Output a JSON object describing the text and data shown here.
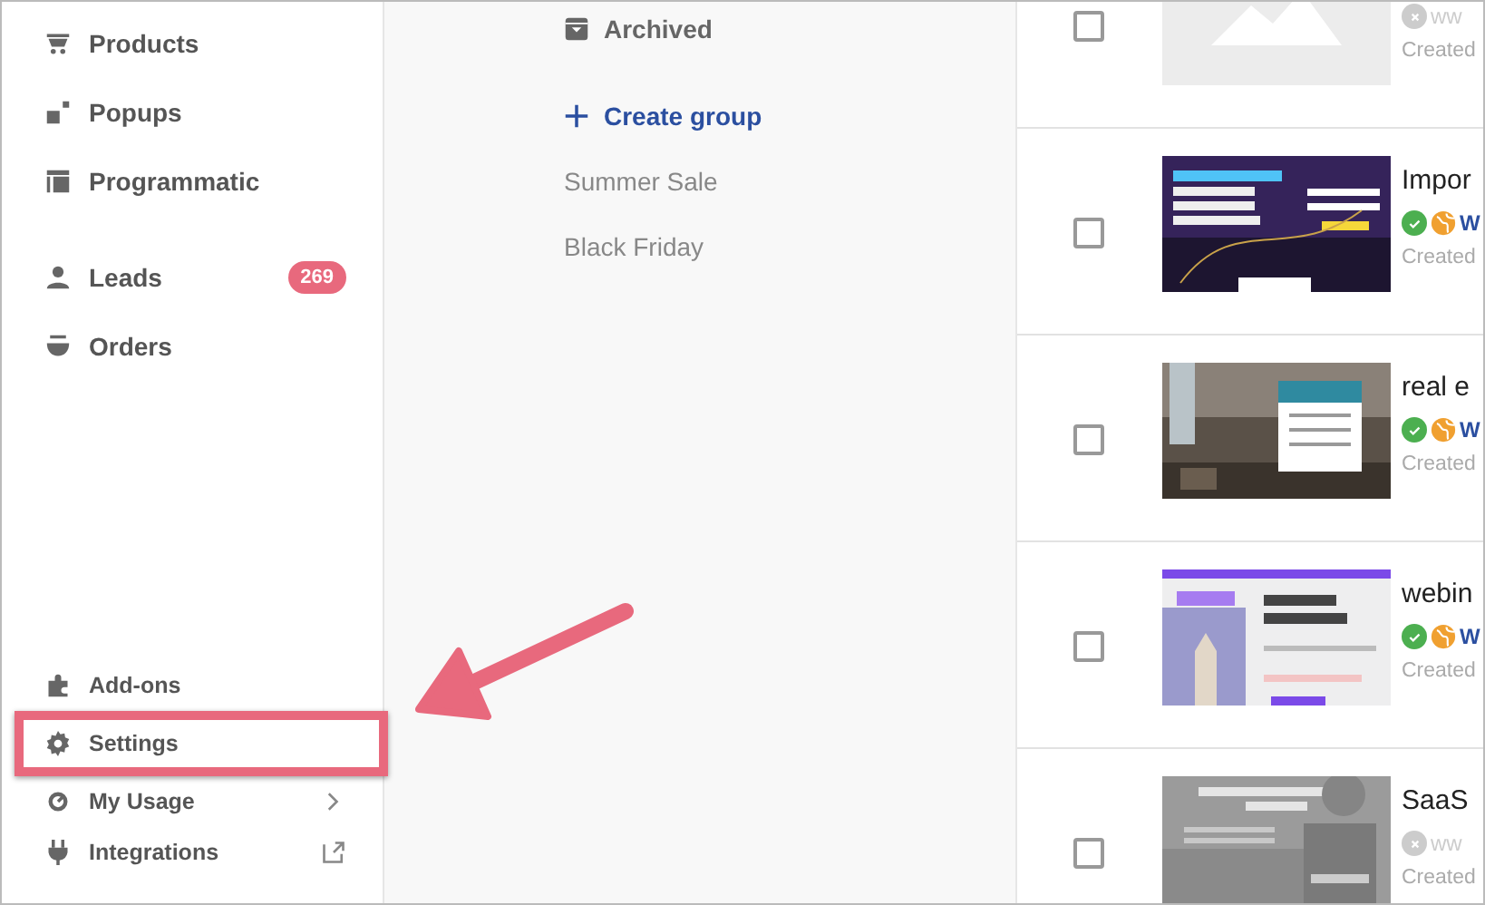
{
  "sidebar": {
    "top_items": [
      {
        "kind": "products",
        "label": "Products"
      },
      {
        "kind": "popups",
        "label": "Popups"
      },
      {
        "kind": "programmatic",
        "label": "Programmatic"
      },
      {
        "kind": "leads",
        "label": "Leads",
        "badge": "269"
      },
      {
        "kind": "orders",
        "label": "Orders"
      }
    ],
    "bottom_items": [
      {
        "kind": "addons",
        "label": "Add-ons",
        "highlighted": false
      },
      {
        "kind": "settings",
        "label": "Settings",
        "highlighted": true
      },
      {
        "kind": "usage",
        "label": "My Usage",
        "chevron": true,
        "highlighted": false
      },
      {
        "kind": "integrations",
        "label": "Integrations",
        "external_link": true,
        "highlighted": false
      }
    ]
  },
  "groups": {
    "archived": "Archived",
    "create": "Create group",
    "items": [
      "Summer Sale",
      "Black Friday"
    ]
  },
  "pages": [
    {
      "kind": "placeholder",
      "checked": false,
      "published": false,
      "url": "ww",
      "created": "Created"
    },
    {
      "kind": "picture",
      "checked": false,
      "title": "Impor",
      "published": true,
      "url": "W",
      "created": "Created"
    },
    {
      "kind": "picture",
      "checked": false,
      "title": "real e",
      "published": true,
      "url": "W",
      "created": "Created"
    },
    {
      "kind": "picture",
      "checked": false,
      "title": "webin",
      "published": true,
      "url": "W",
      "created": "Created"
    },
    {
      "kind": "picture",
      "checked": false,
      "title": "SaaS",
      "published": false,
      "url": "ww",
      "created": "Created"
    }
  ]
}
